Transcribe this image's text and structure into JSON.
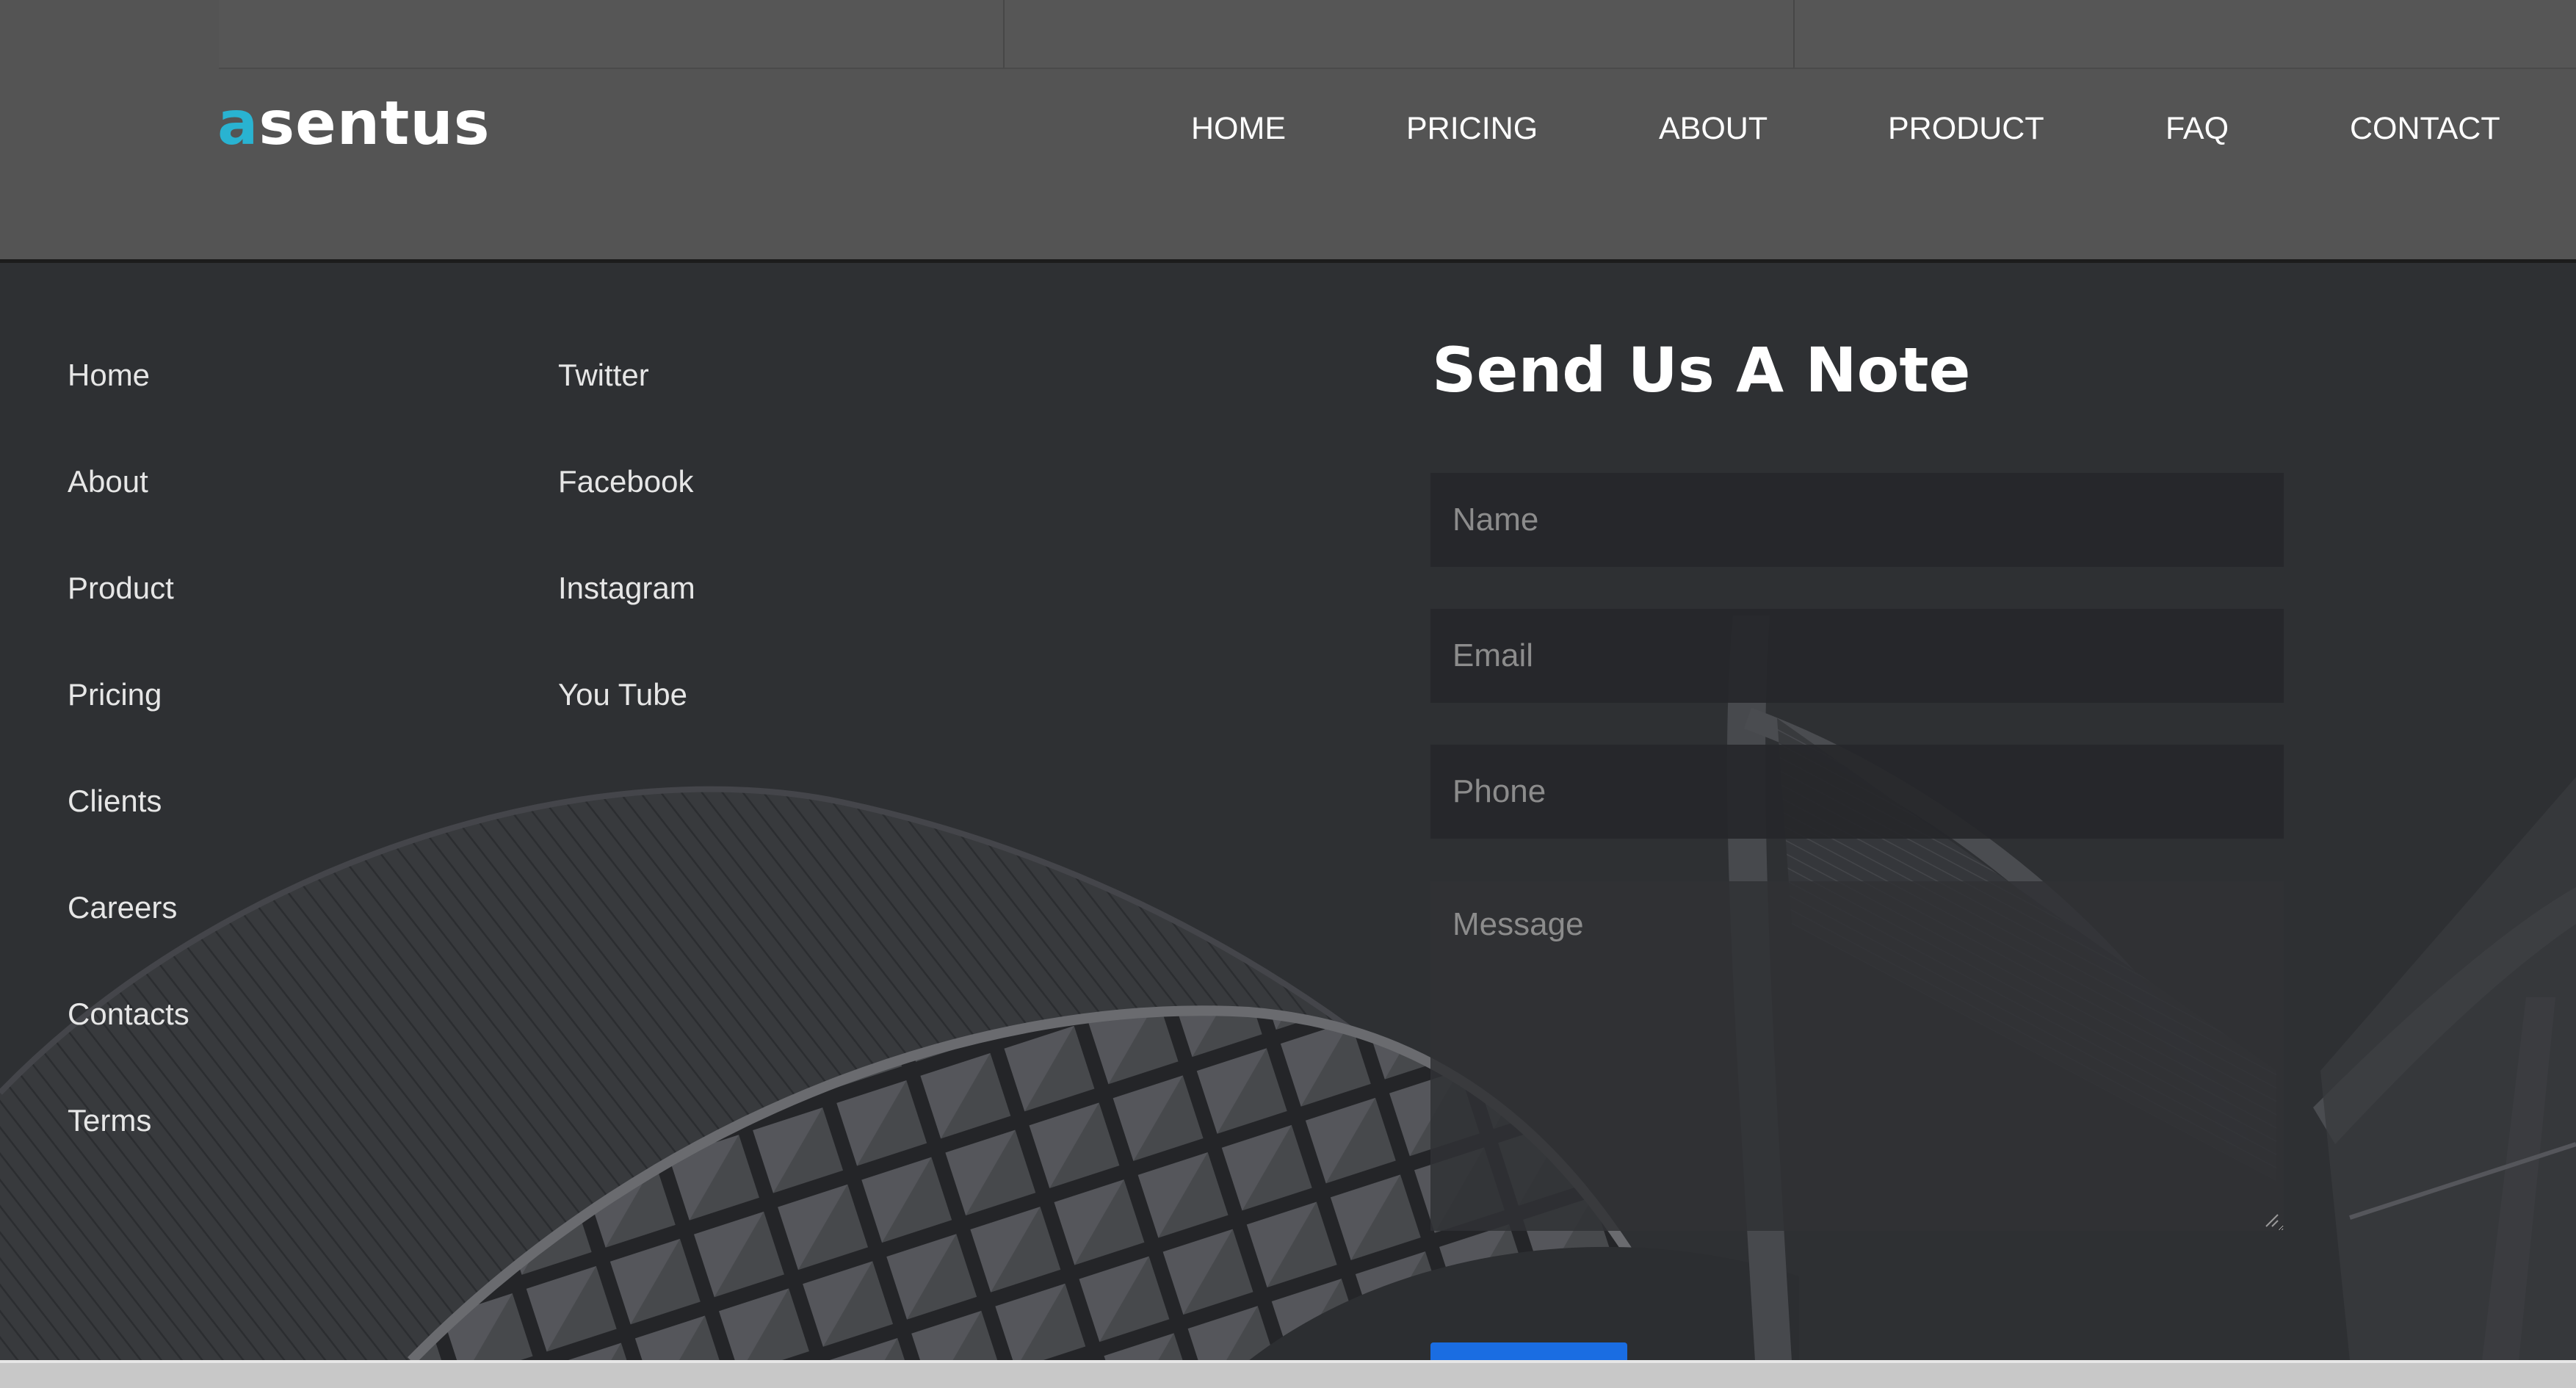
{
  "header": {
    "logo": {
      "accent": "a",
      "rest": "sentus"
    },
    "nav": [
      "HOME",
      "PRICING",
      "ABOUT",
      "PRODUCT",
      "FAQ",
      "CONTACT"
    ]
  },
  "footer": {
    "site_links": [
      "Home",
      "About",
      "Product",
      "Pricing",
      "Clients",
      "Careers",
      "Contacts",
      "Terms"
    ],
    "social_links": [
      "Twitter",
      "Facebook",
      "Instagram",
      "You Tube"
    ]
  },
  "contact_form": {
    "title": "Send Us A Note",
    "name_placeholder": "Name",
    "email_placeholder": "Email",
    "phone_placeholder": "Phone",
    "message_placeholder": "Message"
  },
  "colors": {
    "accent": "#29b3d1",
    "header_bg": "#545454",
    "footer_bg": "#2f3033",
    "button": "#1a6de2"
  }
}
